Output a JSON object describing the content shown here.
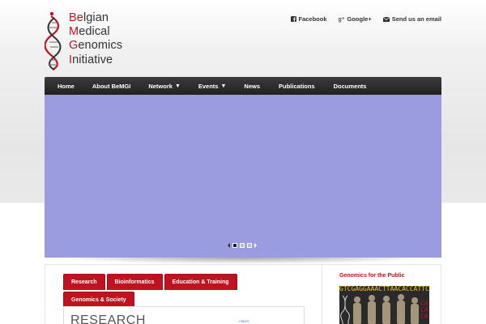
{
  "brand": {
    "lines": [
      {
        "initial": "Be",
        "rest": "lgian"
      },
      {
        "initial": "M",
        "rest": "edical"
      },
      {
        "initial": "G",
        "rest": "enomics"
      },
      {
        "initial": "I",
        "rest": "nitiative"
      }
    ],
    "accent_color": "#c1121f"
  },
  "top_links": [
    {
      "label": "Facebook",
      "icon": "facebook-icon"
    },
    {
      "label": "Google+",
      "icon": "google-plus-icon"
    },
    {
      "label": "Send us an email",
      "icon": "envelope-icon"
    }
  ],
  "nav": {
    "items": [
      {
        "label": "Home",
        "has_dropdown": false
      },
      {
        "label": "About BeMGI",
        "has_dropdown": false
      },
      {
        "label": "Network",
        "has_dropdown": true
      },
      {
        "label": "Events",
        "has_dropdown": true
      },
      {
        "label": "News",
        "has_dropdown": false
      },
      {
        "label": "Publications",
        "has_dropdown": false
      },
      {
        "label": "Documents",
        "has_dropdown": false
      }
    ]
  },
  "slider": {
    "background": "#9b9be0",
    "slides": 3,
    "active_slide": 1
  },
  "tabs": [
    "Research",
    "Bioinformatics",
    "Education & Training",
    "Genomics & Society"
  ],
  "panel": {
    "title": "RESEARCH",
    "image_alt": "CMGG"
  },
  "sidebar": {
    "title": "Genomics for the Public",
    "dna_sequence": "GTCGAGGAAACTTAACACCATTCA"
  }
}
